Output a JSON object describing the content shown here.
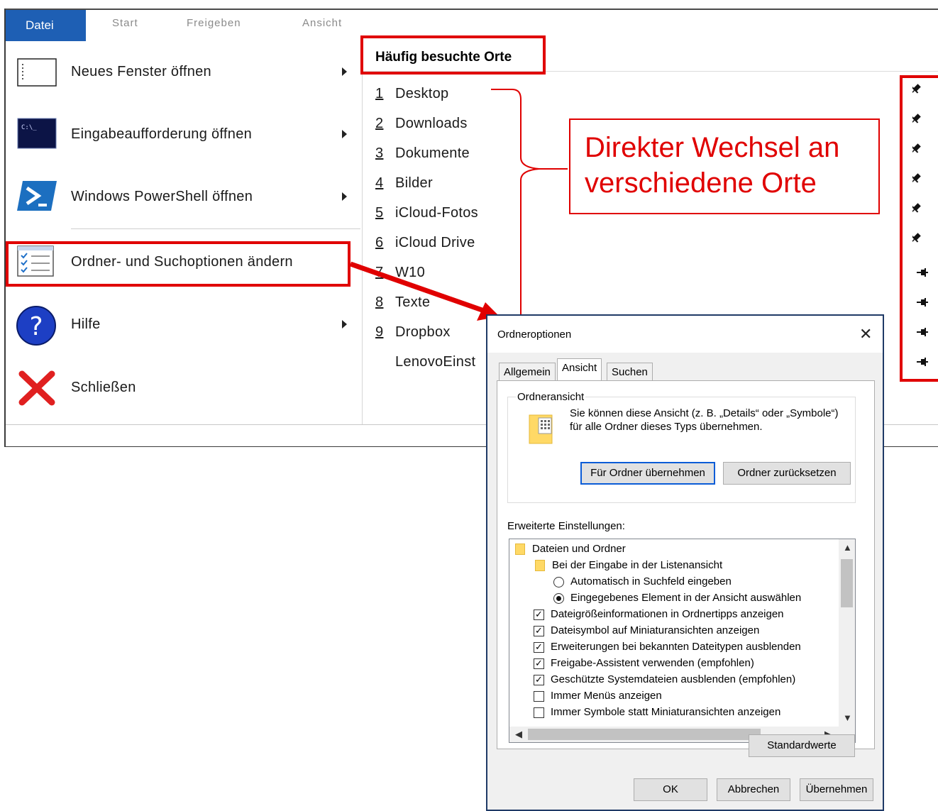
{
  "ribbon": {
    "tabs": [
      "Datei",
      "Start",
      "Freigeben",
      "Ansicht"
    ]
  },
  "file_menu": {
    "items": [
      {
        "label": "Neues Fenster öffnen",
        "icon": "window-icon",
        "submenu": true
      },
      {
        "label": "Eingabeaufforderung öffnen",
        "icon": "command-prompt-icon",
        "submenu": true
      },
      {
        "label": "Windows PowerShell öffnen",
        "icon": "powershell-icon",
        "submenu": true
      },
      {
        "label": "Ordner- und Suchoptionen ändern",
        "icon": "folder-options-icon",
        "submenu": false
      },
      {
        "label": "Hilfe",
        "icon": "help-icon",
        "submenu": true
      },
      {
        "label": "Schließen",
        "icon": "close-x-icon",
        "submenu": false
      }
    ]
  },
  "recent": {
    "header": "Häufig besuchte Orte",
    "items": [
      {
        "num": "1",
        "name": "Desktop"
      },
      {
        "num": "2",
        "name": "Downloads"
      },
      {
        "num": "3",
        "name": "Dokumente"
      },
      {
        "num": "4",
        "name": "Bilder"
      },
      {
        "num": "5",
        "name": "iCloud-Fotos"
      },
      {
        "num": "6",
        "name": "iCloud Drive"
      },
      {
        "num": "7",
        "name": "W10"
      },
      {
        "num": "8",
        "name": "Texte"
      },
      {
        "num": "9",
        "name": "Dropbox"
      },
      {
        "num": "",
        "name": "LenovoEinst"
      }
    ],
    "pins": [
      "pinned",
      "pinned",
      "pinned",
      "pinned",
      "pinned",
      "pinned",
      "unpinned",
      "unpinned",
      "unpinned",
      "unpinned"
    ]
  },
  "annotation": {
    "callout_line1": "Direkter Wechsel an",
    "callout_line2": "verschiedene Orte",
    "color": "#e00000"
  },
  "dialog": {
    "title": "Ordneroptionen",
    "tabs": [
      "Allgemein",
      "Ansicht",
      "Suchen"
    ],
    "active_tab": "Ansicht",
    "group_title": "Ordneransicht",
    "group_text": "Sie können diese Ansicht (z. B. „Details“ oder „Symbole“) für alle Ordner dieses Typs übernehmen.",
    "btn_apply_folders": "Für Ordner übernehmen",
    "btn_reset_folders": "Ordner zurücksetzen",
    "advanced_label": "Erweiterte Einstellungen:",
    "tree": [
      {
        "type": "folder",
        "label": "Dateien und Ordner"
      },
      {
        "type": "folder",
        "label": "Bei der Eingabe in der Listenansicht"
      },
      {
        "type": "radio",
        "checked": false,
        "label": "Automatisch in Suchfeld eingeben"
      },
      {
        "type": "radio",
        "checked": true,
        "label": "Eingegebenes Element in der Ansicht auswählen"
      },
      {
        "type": "check",
        "checked": true,
        "label": "Dateigrößeinformationen in Ordnertipps anzeigen"
      },
      {
        "type": "check",
        "checked": true,
        "label": "Dateisymbol auf Miniaturansichten anzeigen"
      },
      {
        "type": "check",
        "checked": true,
        "label": "Erweiterungen bei bekannten Dateitypen ausblenden"
      },
      {
        "type": "check",
        "checked": true,
        "label": "Freigabe-Assistent verwenden (empfohlen)"
      },
      {
        "type": "check",
        "checked": true,
        "label": "Geschützte Systemdateien ausblenden (empfohlen)"
      },
      {
        "type": "check",
        "checked": false,
        "label": "Immer Menüs anzeigen"
      },
      {
        "type": "check",
        "checked": false,
        "label": "Immer Symbole statt Miniaturansichten anzeigen"
      }
    ],
    "btn_defaults": "Standardwerte",
    "btn_ok": "OK",
    "btn_cancel": "Abbrechen",
    "btn_apply": "Übernehmen"
  }
}
